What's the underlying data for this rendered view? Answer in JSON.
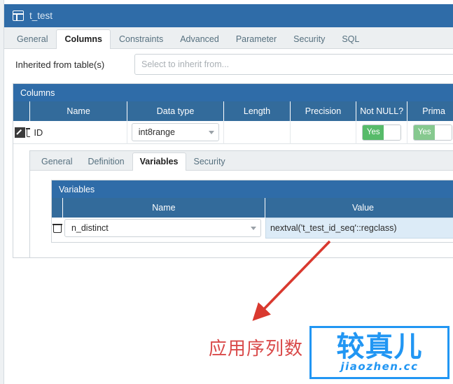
{
  "window": {
    "title": "t_test",
    "icon": "table-icon"
  },
  "main_tabs": [
    {
      "label": "General",
      "active": false
    },
    {
      "label": "Columns",
      "active": true
    },
    {
      "label": "Constraints",
      "active": false
    },
    {
      "label": "Advanced",
      "active": false
    },
    {
      "label": "Parameter",
      "active": false
    },
    {
      "label": "Security",
      "active": false
    },
    {
      "label": "SQL",
      "active": false
    }
  ],
  "inherited": {
    "label": "Inherited from table(s)",
    "placeholder": "Select to inherit from...",
    "value": ""
  },
  "columns_panel": {
    "title": "Columns",
    "headers": [
      "",
      "Name",
      "Data type",
      "Length",
      "Precision",
      "Not NULL?",
      "Prima"
    ],
    "row": {
      "edit_icon": "edit-pencil-icon",
      "delete_icon": "trash-icon",
      "name": "ID",
      "data_type": "int8range",
      "length": "",
      "precision": "",
      "not_null": "Yes",
      "primary_key": "Yes"
    }
  },
  "detail_tabs": [
    {
      "label": "General",
      "active": false
    },
    {
      "label": "Definition",
      "active": false
    },
    {
      "label": "Variables",
      "active": true
    },
    {
      "label": "Security",
      "active": false
    }
  ],
  "variables_panel": {
    "title": "Variables",
    "headers": [
      "",
      "Name",
      "Value"
    ],
    "row": {
      "delete_icon": "trash-icon",
      "name": "n_distinct",
      "value": "nextval('t_test_id_seq'::regclass)"
    }
  },
  "annotation": {
    "text": "应用序列数",
    "color": "#d94a4a",
    "arrow": "red-arrow-pointing-down-left"
  },
  "watermark": {
    "main": "较真儿",
    "sub": "jiaozhen.cc",
    "color": "#2196f3"
  },
  "colors": {
    "header_blue": "#2f6ca8",
    "grid_blue": "#336b9b",
    "toggle_green": "#57bb6a",
    "selected_row": "#dcebf7"
  }
}
